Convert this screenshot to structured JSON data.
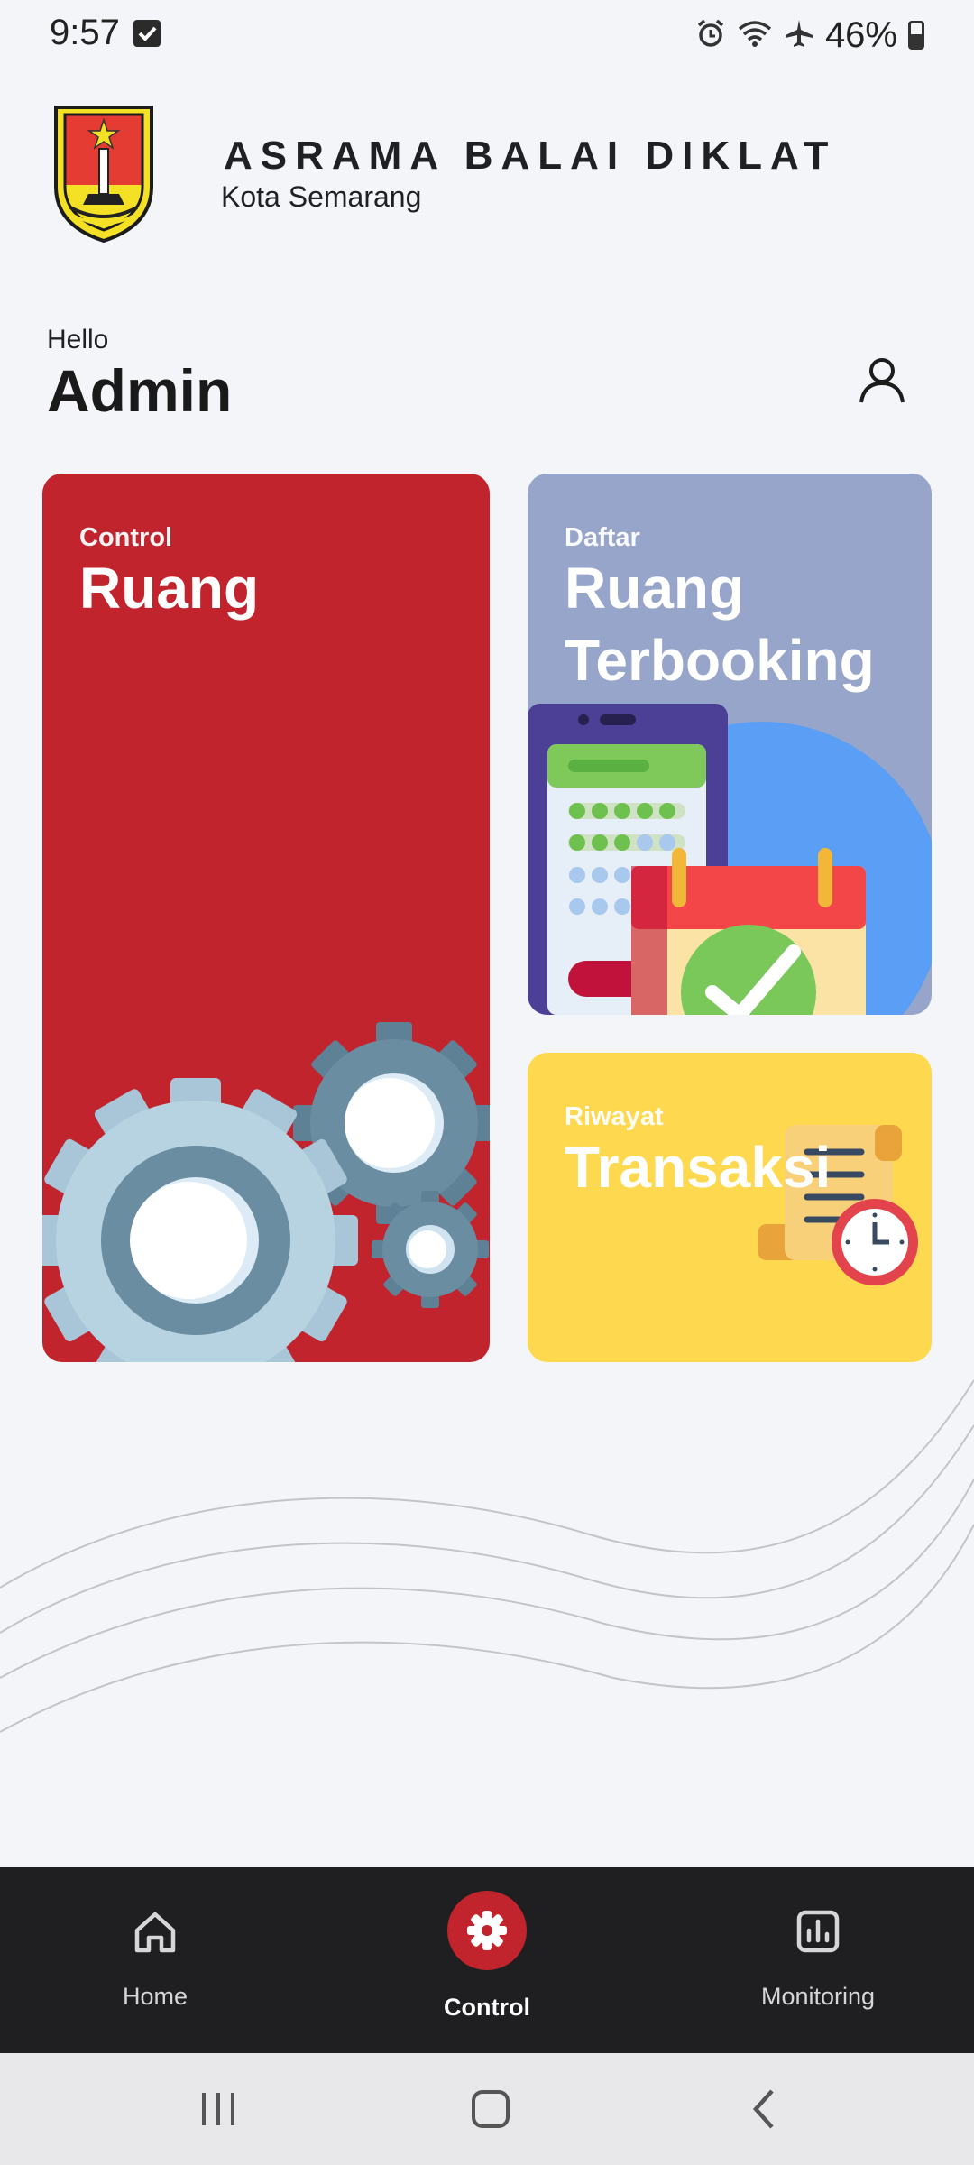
{
  "status_bar": {
    "time": "9:57",
    "battery": "46%",
    "icons": [
      "checkbox-notification-icon",
      "alarm-icon",
      "wifi-icon",
      "airplane-icon",
      "battery-icon"
    ]
  },
  "header": {
    "title": "ASRAMA BALAI DIKLAT",
    "subtitle": "Kota Semarang",
    "logo": "city-emblem-logo"
  },
  "greeting": {
    "hello": "Hello",
    "name": "Admin"
  },
  "cards": {
    "control": {
      "small": "Control",
      "big": "Ruang",
      "color": "#c1242d"
    },
    "daftar": {
      "small": "Daftar",
      "big": "Ruang Terbooking",
      "color": "#96a5c9"
    },
    "riwayat": {
      "small": "Riwayat",
      "big": "Transaksi",
      "color": "#fed84e"
    }
  },
  "bottom_nav": {
    "items": [
      {
        "label": "Home",
        "icon": "home-icon"
      },
      {
        "label": "Control",
        "icon": "gear-icon",
        "active": true
      },
      {
        "label": "Monitoring",
        "icon": "chart-icon"
      }
    ],
    "active_color": "#c1242d"
  },
  "system_nav": {
    "icons": [
      "recent-apps-icon",
      "home-circle-icon",
      "back-icon"
    ]
  }
}
